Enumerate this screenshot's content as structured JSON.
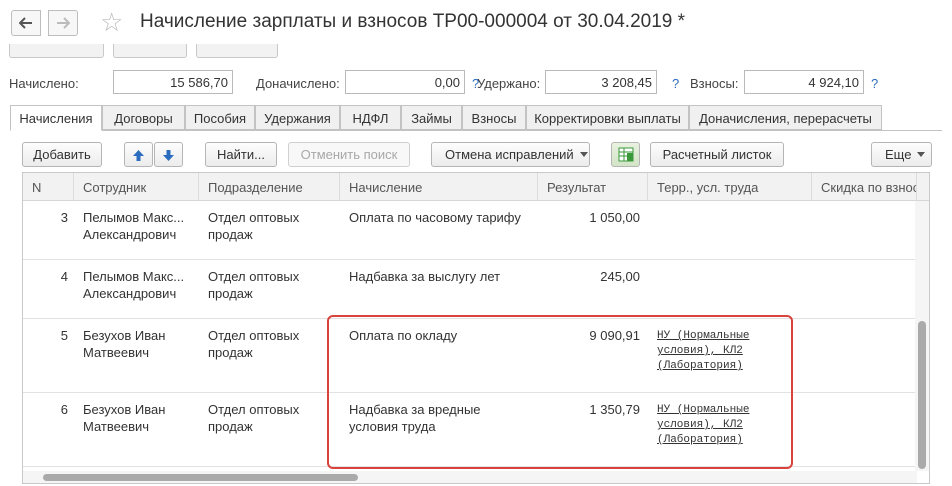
{
  "window": {
    "title": "Начисление зарплаты и взносов ТР00-000004 от 30.04.2019 *"
  },
  "totals": {
    "accrued_label": "Начислено:",
    "accrued_value": "15 586,70",
    "additional_label": "Доначислено:",
    "additional_value": "0,00",
    "withheld_label": "Удержано:",
    "withheld_value": "3 208,45",
    "contributions_label": "Взносы:",
    "contributions_value": "4 924,10",
    "help_mark": "?"
  },
  "tabs": [
    {
      "label": "Начисления",
      "active": true
    },
    {
      "label": "Договоры"
    },
    {
      "label": "Пособия"
    },
    {
      "label": "Удержания"
    },
    {
      "label": "НДФЛ"
    },
    {
      "label": "Займы"
    },
    {
      "label": "Взносы"
    },
    {
      "label": "Корректировки выплаты"
    },
    {
      "label": "Доначисления, перерасчеты"
    }
  ],
  "toolbar": {
    "add_label": "Добавить",
    "find_label": "Найти...",
    "cancel_search_label": "Отменить поиск",
    "cancel_corrections_label": "Отмена исправлений",
    "payslip_label": "Расчетный листок",
    "more_label": "Еще"
  },
  "table": {
    "columns": [
      "N",
      "Сотрудник",
      "Подразделение",
      "Начисление",
      "Результат",
      "Терр., усл. труда",
      "Скидка по взнос"
    ],
    "rows": [
      {
        "n": "3",
        "employee": "Пелымов Макс...\nАлександрович",
        "department": "Отдел оптовых\nпродаж",
        "accrual": "Оплата по часовому тарифу",
        "result": "1 050,00",
        "terr": ""
      },
      {
        "n": "4",
        "employee": "Пелымов Макс...\nАлександрович",
        "department": "Отдел оптовых\nпродаж",
        "accrual": "Надбавка за выслугу лет",
        "result": "245,00",
        "terr": ""
      },
      {
        "n": "5",
        "employee": "Безухов Иван\nМатвеевич",
        "department": "Отдел оптовых\nпродаж",
        "accrual": "Оплата по окладу",
        "result": "9 090,91",
        "terr": "НУ (Нормальные\nусловия), КЛ2\n(Лаборатория)"
      },
      {
        "n": "6",
        "employee": "Безухов Иван\nМатвеевич",
        "department": "Отдел оптовых\nпродаж",
        "accrual": "Надбавка за вредные\nусловия труда",
        "result": "1 350,79",
        "terr": "НУ (Нормальные\nусловия), КЛ2\n(Лаборатория)"
      }
    ]
  },
  "colors": {
    "highlight": "#d9433b",
    "help": "#2a6dbf",
    "arrow": "#2a6dbf",
    "payslip_icon": "#3a9a3a"
  },
  "icons": {
    "back": "arrow-left-icon",
    "forward": "arrow-right-icon",
    "favorite": "star-icon",
    "move_up": "arrow-up-icon",
    "move_down": "arrow-down-icon",
    "grid_settings": "table-icon"
  }
}
